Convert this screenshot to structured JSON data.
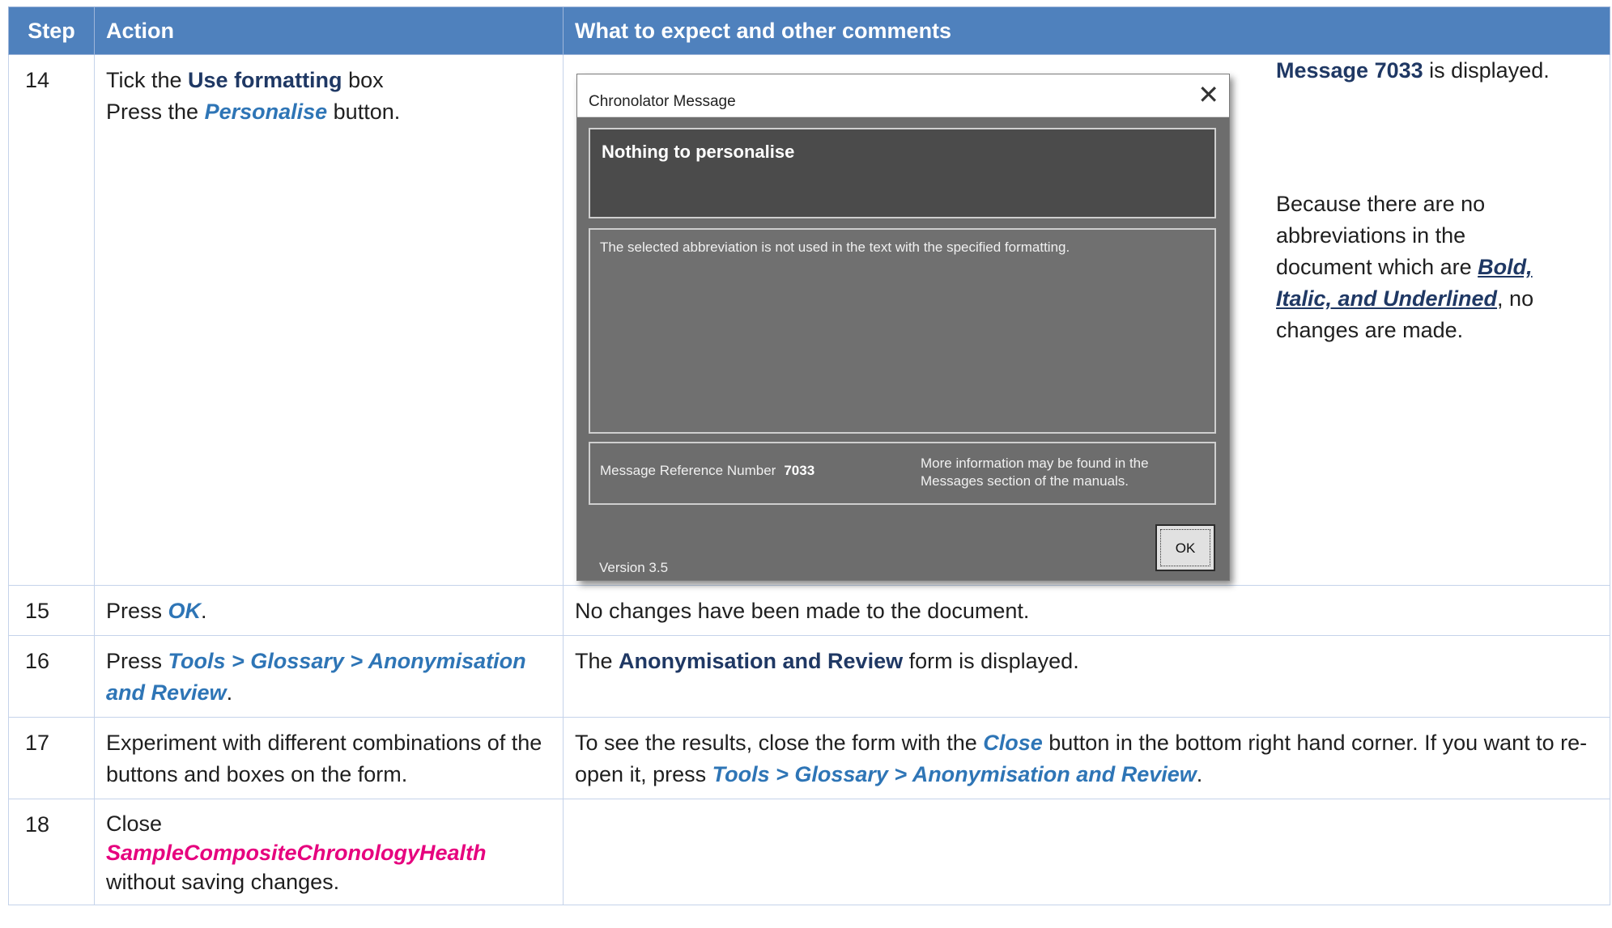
{
  "header": {
    "step": "Step",
    "action": "Action",
    "comments": "What to expect and other comments"
  },
  "rows": [
    {
      "step": "14",
      "action": {
        "t1": "Tick the ",
        "b1": "Use formatting",
        "t2": "  box",
        "t3": "Press the ",
        "l1": "Personalise",
        "t4": "  button."
      },
      "comment": {
        "b1": "Message 7033",
        "t1": " is displayed.",
        "t2": "Because there are no abbreviations in the document which are ",
        "biu": "Bold, Italic, and Underlined",
        "t3": ", no changes are made."
      },
      "dialog": {
        "title": "Chronolator Message",
        "close": "✕",
        "heading": "Nothing to personalise",
        "message": "The selected abbreviation is not used in the text with the specified formatting.",
        "ref_label": "Message Reference Number",
        "ref_number": "7033",
        "info": "More information may be found in the Messages section of the manuals.",
        "version": "Version 3.5",
        "ok": "OK"
      }
    },
    {
      "step": "15",
      "action": {
        "t1": "Press ",
        "l1": "OK",
        "t2": "."
      },
      "comment": {
        "t1": "No changes have been made to the document."
      }
    },
    {
      "step": "16",
      "action": {
        "t1": "Press ",
        "l1": "Tools > Glossary > Anonymisation and Review",
        "t2": "."
      },
      "comment": {
        "t1": "The ",
        "b1": "Anonymisation and Review",
        "t2": " form is displayed."
      }
    },
    {
      "step": "17",
      "action": {
        "t1": "Experiment with different combinations of the buttons and boxes on the form."
      },
      "comment": {
        "t1": "To see the results, close the form with the ",
        "l1": "Close",
        "t2": "  button in the bottom right hand corner. If you want to re-open it, press ",
        "l2": "Tools > Glossary > Anonymisation and Review",
        "t3": "."
      }
    },
    {
      "step": "18",
      "action": {
        "t1": "Close",
        "p1": "SampleCompositeChronologyHealth",
        "t2": "without saving changes."
      },
      "comment": {}
    }
  ]
}
